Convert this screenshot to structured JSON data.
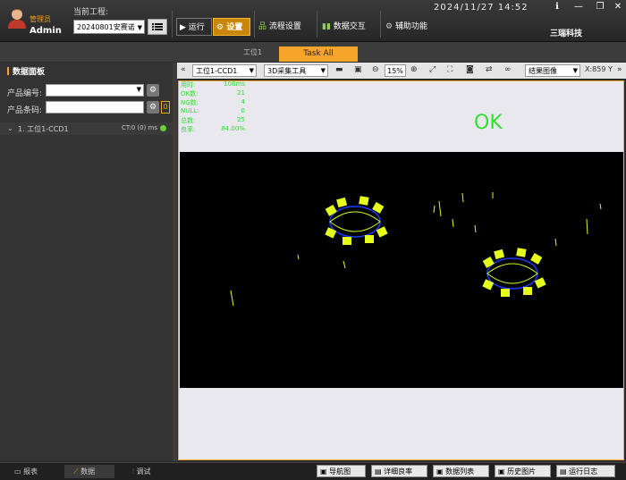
{
  "header": {
    "role": "管理员",
    "user": "Admin",
    "project_label": "当前工程:",
    "project_value": "20240801安赛诺",
    "run_label": "运行",
    "settings_label": "设置",
    "flow_label": "流程设置",
    "data_label": "数据交互",
    "aux_label": "辅助功能",
    "datetime": "2024/11/27 14:52",
    "brand": "三瑞科技"
  },
  "tabs": {
    "station1": "工位1",
    "task_all": "Task All"
  },
  "sidebar": {
    "title": "数据面板",
    "product_no_label": "产品编号:",
    "product_code_label": "产品条码:",
    "counter": "0",
    "station_row": "1. 工位1-CCD1",
    "ct": "CT:0 (0) ms"
  },
  "toolbar": {
    "station_select": "工位1-CCD1",
    "tool_select": "3D采集工具",
    "zoom": "15%",
    "view_select": "结果图像",
    "coord": "X:859 Y"
  },
  "result": {
    "status": "OK",
    "stats": [
      {
        "label": "用时:",
        "value": "106ms"
      },
      {
        "label": "OK数:",
        "value": "21"
      },
      {
        "label": "NG数:",
        "value": "4"
      },
      {
        "label": "NULL:",
        "value": "0"
      },
      {
        "label": "总数:",
        "value": "25"
      },
      {
        "label": "良率:",
        "value": "84.00%"
      }
    ]
  },
  "statusbar": {
    "report": "报表",
    "data": "数据",
    "debug": "调试",
    "nav": "导航图",
    "yield": "详细良率",
    "list": "数据列表",
    "history": "历史图片",
    "log": "运行日志"
  }
}
